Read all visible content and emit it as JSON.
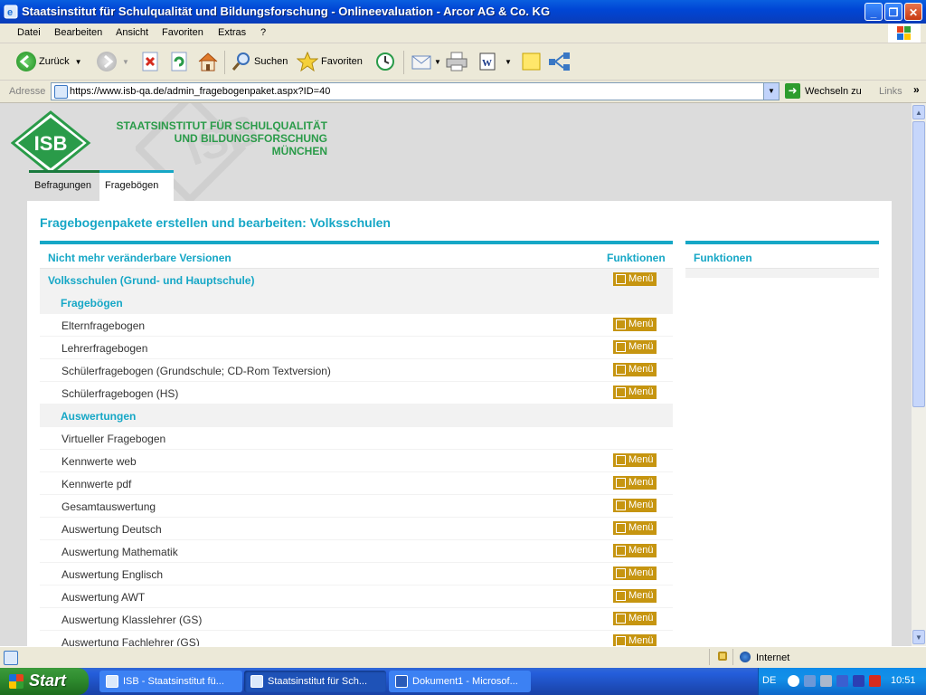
{
  "window": {
    "title": "Staatsinstitut für Schulqualität und Bildungsforschung - Onlineevaluation - Arcor AG & Co. KG",
    "controls": [
      "_",
      "❐",
      "✕"
    ]
  },
  "menubar": [
    "Datei",
    "Bearbeiten",
    "Ansicht",
    "Favoriten",
    "Extras",
    "?"
  ],
  "toolbar": {
    "back_label": "Zurück",
    "search_label": "Suchen",
    "favorites_label": "Favoriten"
  },
  "addressbar": {
    "label": "Adresse",
    "url": "https://www.isb-qa.de/admin_fragebogenpaket.aspx?ID=40",
    "go_label": "Wechseln zu",
    "links_label": "Links"
  },
  "site": {
    "logo_text": "ISB",
    "org_line1": "STAATSINSTITUT FÜR SCHULQUALITÄT",
    "org_line2": "UND BILDUNGSFORSCHUNG",
    "org_line3": "MÜNCHEN",
    "tabs": [
      {
        "label": "Befragungen",
        "active": false
      },
      {
        "label": "Fragebögen",
        "active": true
      }
    ],
    "page_title": "Fragebogenpakete erstellen und bearbeiten: Volksschulen",
    "table_header": {
      "col1": "Nicht mehr veränderbare Versionen",
      "col2": "Funktionen"
    },
    "menu_label": "Menü",
    "rows": [
      {
        "type": "grp",
        "text": "Volksschulen (Grund- und Hauptschule)",
        "menu": true
      },
      {
        "type": "sub",
        "text": "Fragebögen",
        "menu": false
      },
      {
        "type": "item",
        "text": "Elternfragebogen",
        "menu": true
      },
      {
        "type": "item",
        "text": "Lehrerfragebogen",
        "menu": true
      },
      {
        "type": "item",
        "text": "Schülerfragebogen (Grundschule; CD-Rom Textversion)",
        "menu": true
      },
      {
        "type": "item",
        "text": "Schülerfragebogen (HS)",
        "menu": true
      },
      {
        "type": "sub",
        "text": "Auswertungen",
        "menu": false
      },
      {
        "type": "item",
        "text": "Virtueller Fragebogen",
        "menu": false
      },
      {
        "type": "item",
        "text": "Kennwerte web",
        "menu": true
      },
      {
        "type": "item",
        "text": "Kennwerte pdf",
        "menu": true
      },
      {
        "type": "item",
        "text": "Gesamtauswertung",
        "menu": true
      },
      {
        "type": "item",
        "text": "Auswertung Deutsch",
        "menu": true
      },
      {
        "type": "item",
        "text": "Auswertung Mathematik",
        "menu": true
      },
      {
        "type": "item",
        "text": "Auswertung Englisch",
        "menu": true
      },
      {
        "type": "item",
        "text": "Auswertung AWT",
        "menu": true
      },
      {
        "type": "item",
        "text": "Auswertung Klasslehrer (GS)",
        "menu": true
      },
      {
        "type": "item",
        "text": "Auswertung Fachlehrer (GS)",
        "menu": true
      }
    ],
    "side_header": "Funktionen"
  },
  "statusbar": {
    "zone": "Internet"
  },
  "taskbar": {
    "start_label": "Start",
    "tasks": [
      "ISB - Staatsinstitut fü...",
      "Staatsinstitut für Sch...",
      "Dokument1 - Microsof..."
    ],
    "lang": "DE",
    "clock": "10:51"
  },
  "colors": {
    "accent": "#16a7c6",
    "brand_green": "#2a9b49",
    "menu_button": "#c69510"
  }
}
